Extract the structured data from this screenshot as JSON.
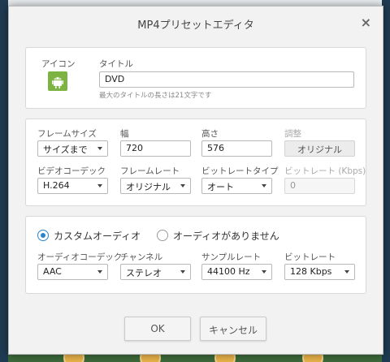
{
  "dialog": {
    "title": "MP4プリセットエディタ",
    "close_glyph": "×"
  },
  "header_panel": {
    "icon_label": "アイコン",
    "title_label": "タイトル",
    "title_value": "DVD",
    "title_hint": "最大のタイトルの長さは21文字です",
    "icon_name": "android-icon",
    "icon_color": "#7cb342"
  },
  "video_panel": {
    "frame_size_label": "フレームサイズ",
    "frame_size_value": "サイズまで",
    "width_label": "幅",
    "width_value": "720",
    "height_label": "高さ",
    "height_value": "576",
    "adjust_label": "調整",
    "adjust_button": "オリジナル",
    "video_codec_label": "ビデオコーデック",
    "video_codec_value": "H.264",
    "frame_rate_label": "フレームレート",
    "frame_rate_value": "オリジナル",
    "bitrate_type_label": "ビットレートタイプ",
    "bitrate_type_value": "オート",
    "bitrate_label": "ビットレート (Kbps)",
    "bitrate_value": "0"
  },
  "audio_panel": {
    "custom_audio_label": "カスタムオーディオ",
    "no_audio_label": "オーディオがありません",
    "selected": "custom",
    "audio_codec_label": "オーディオコーデック",
    "audio_codec_value": "AAC",
    "channel_label": "チャンネル",
    "channel_value": "ステレオ",
    "sample_rate_label": "サンプルレート",
    "sample_rate_value": "44100 Hz",
    "audio_bitrate_label": "ビットレート",
    "audio_bitrate_value": "128 Kbps"
  },
  "footer": {
    "ok_label": "OK",
    "cancel_label": "キャンセル"
  },
  "colors": {
    "accent": "#2a84c8",
    "dialog_bg": "#f2f2f2",
    "panel_bg": "#ffffff"
  }
}
